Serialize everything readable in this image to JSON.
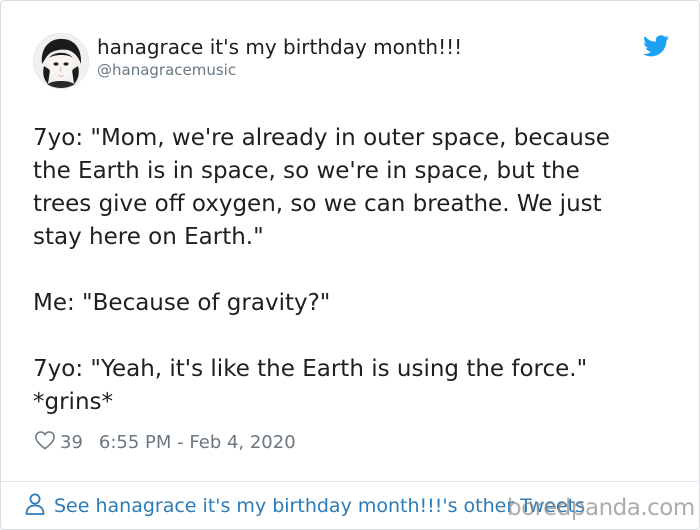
{
  "author": {
    "display_name": "hanagrace it's my birthday month!!!",
    "handle": "@hanagracemusic",
    "avatar_icon": "avatar-photo"
  },
  "tweet": {
    "text": "7yo: \"Mom, we're already in outer space, because\nthe Earth is in space, so we're in space, but the\ntrees give off oxygen, so we can breathe. We just\nstay here on Earth.\"\n\nMe: \"Because of gravity?\"\n\n7yo: \"Yeah, it's like the Earth is using the force.\"\n*grins*"
  },
  "meta": {
    "likes": "39",
    "timestamp": "6:55 PM - Feb 4, 2020"
  },
  "footer": {
    "link_label": "See hanagrace it's my birthday month!!!'s other Tweets"
  },
  "watermark": "boredpanda.com",
  "colors": {
    "text": "#1c2022",
    "secondary": "#697882",
    "link": "#2b7bb9",
    "twitter_blue": "#1da1f2",
    "border": "#e1e8ed"
  },
  "icons": {
    "brand": "twitter-bird-icon",
    "like": "heart-icon",
    "profile": "person-icon"
  }
}
